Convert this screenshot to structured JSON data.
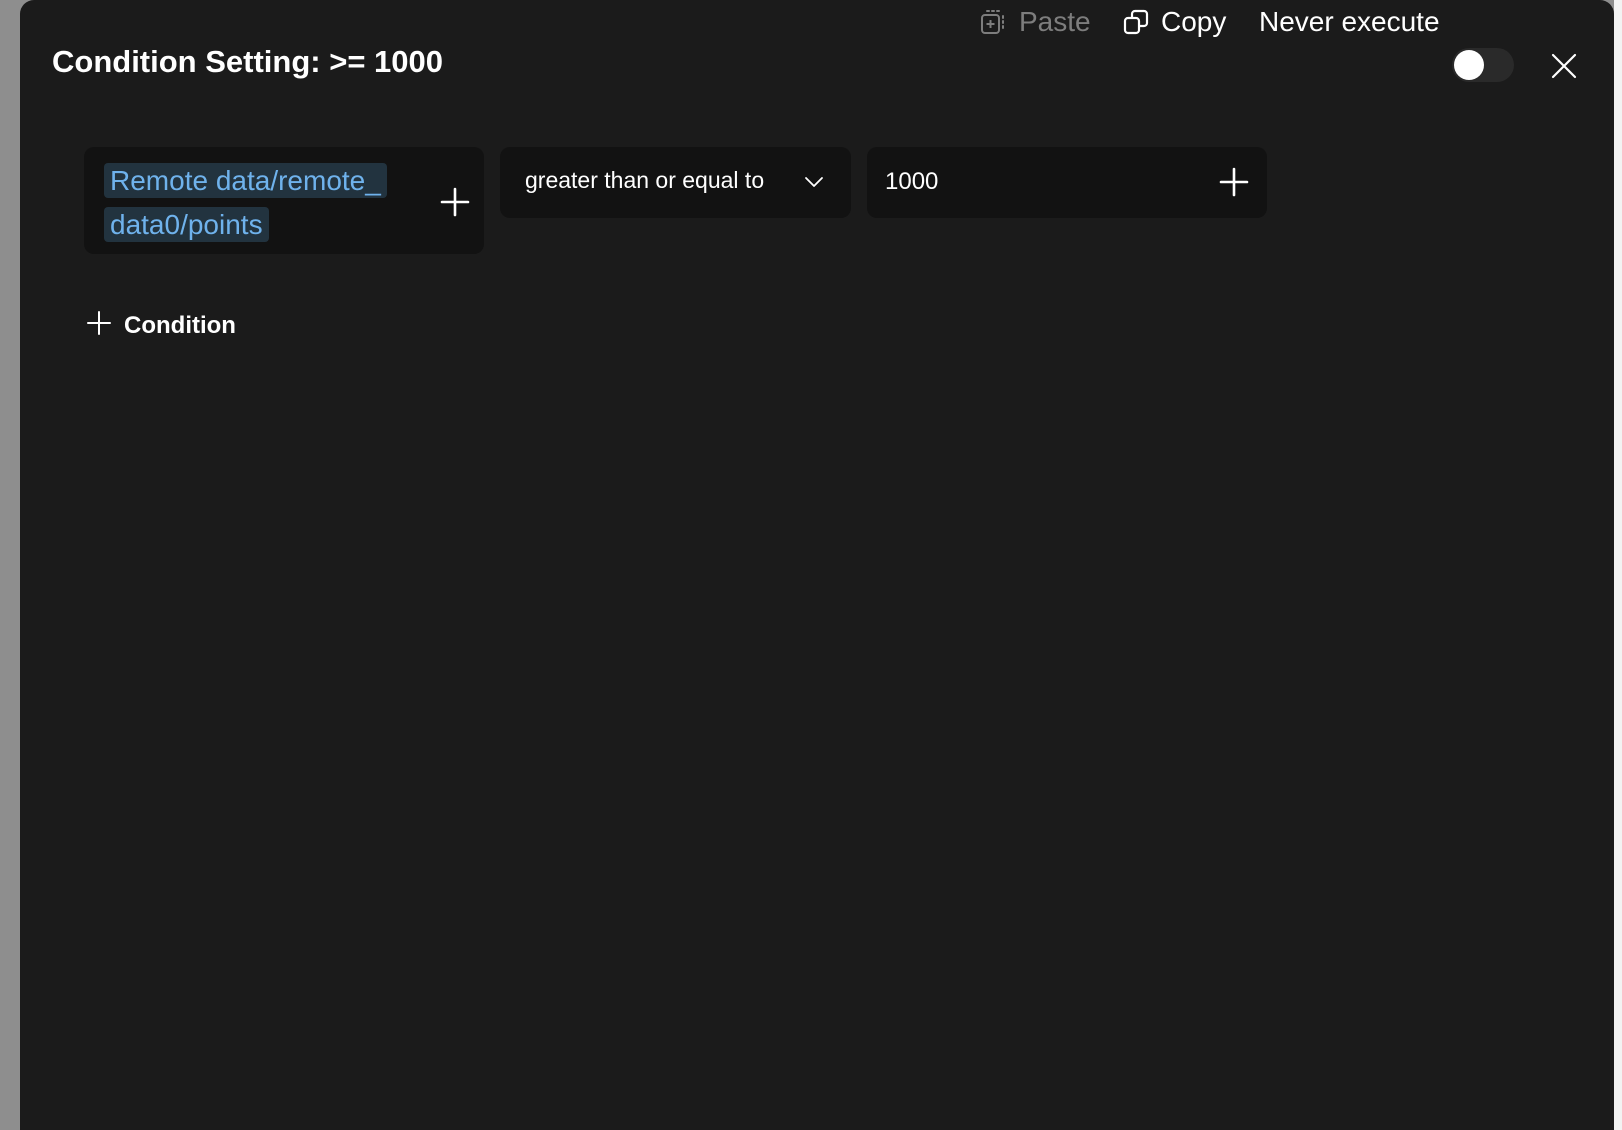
{
  "dialog": {
    "title": "Condition Setting: >= 1000",
    "paste_label": "Paste",
    "copy_label": "Copy",
    "never_execute_label": "Never execute",
    "never_execute_on": false
  },
  "condition": {
    "variable_line1": "Remote data/remote_",
    "variable_line2": "data0/points",
    "operator": "greater than or equal to",
    "value": "1000"
  },
  "add_condition_label": "Condition",
  "colors": {
    "background": "#1b1b1b",
    "field": "#121212",
    "variable_text": "#6fb2ec",
    "variable_chip": "#22333f",
    "disabled_text": "#7d7d7d"
  }
}
